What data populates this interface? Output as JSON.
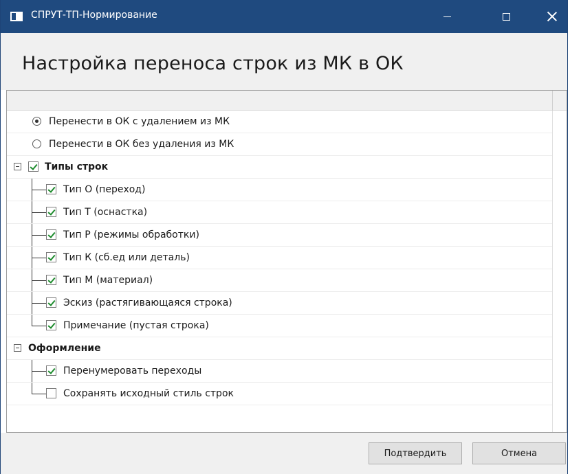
{
  "window": {
    "title": "СПРУТ-ТП-Нормирование",
    "icon": "app-window-icon",
    "controls": [
      "minimize",
      "maximize",
      "close"
    ]
  },
  "header": {
    "title": "Настройка переноса строк из МК в ОК"
  },
  "options": {
    "radios": [
      {
        "label": "Перенести в ОК с удалением из МК",
        "checked": true
      },
      {
        "label": "Перенести в ОК без удаления из МК",
        "checked": false
      }
    ]
  },
  "groups": [
    {
      "label": "Типы строк",
      "expanded": true,
      "checked": true,
      "items": [
        {
          "label": "Тип О (переход)",
          "checked": true
        },
        {
          "label": "Тип Т (оснастка)",
          "checked": true
        },
        {
          "label": "Тип Р (режимы обработки)",
          "checked": true
        },
        {
          "label": "Тип К (сб.ед или деталь)",
          "checked": true
        },
        {
          "label": "Тип М (материал)",
          "checked": true
        },
        {
          "label": "Эскиз (растягивающаяся строка)",
          "checked": true
        },
        {
          "label": "Примечание (пустая строка)",
          "checked": true
        }
      ]
    },
    {
      "label": "Оформление",
      "expanded": true,
      "items": [
        {
          "label": "Перенумеровать переходы",
          "checked": true
        },
        {
          "label": "Сохранять исходный стиль строк",
          "checked": false
        }
      ]
    }
  ],
  "footer": {
    "confirm_label": "Подтвердить",
    "cancel_label": "Отмена"
  },
  "colors": {
    "titlebar": "#1f4a7f",
    "check_mark": "#1b8a2b"
  }
}
